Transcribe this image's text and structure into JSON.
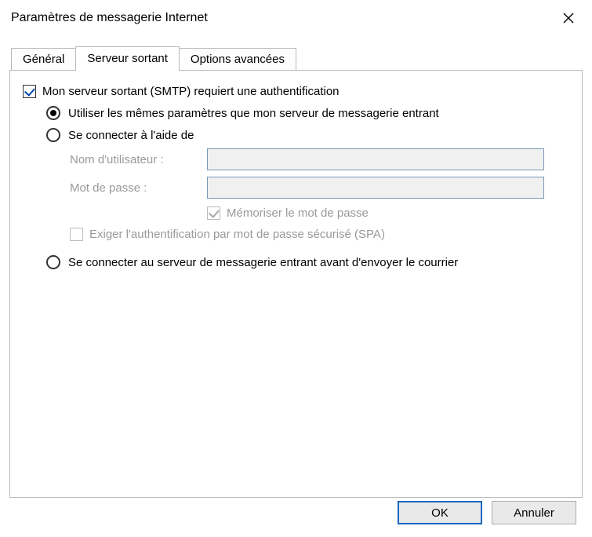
{
  "window": {
    "title": "Paramètres de messagerie Internet"
  },
  "tabs": {
    "general": "Général",
    "outgoing": "Serveur sortant",
    "advanced": "Options avancées",
    "active": "outgoing"
  },
  "form": {
    "smtp_auth_label": "Mon serveur sortant (SMTP) requiert une authentification",
    "smtp_auth_checked": true,
    "opt_same_label": "Utiliser les mêmes paramètres que mon serveur de messagerie entrant",
    "opt_logon_label": "Se connecter à l'aide de",
    "username_label": "Nom d'utilisateur :",
    "username_value": "",
    "password_label": "Mot de passe :",
    "password_value": "",
    "remember_label": "Mémoriser le mot de passe",
    "remember_checked": true,
    "spa_label": "Exiger l'authentification par mot de passe sécurisé (SPA)",
    "spa_checked": false,
    "opt_before_send_label": "Se connecter au serveur de messagerie entrant avant d'envoyer le courrier",
    "selected_option": "same"
  },
  "buttons": {
    "ok": "OK",
    "cancel": "Annuler"
  }
}
